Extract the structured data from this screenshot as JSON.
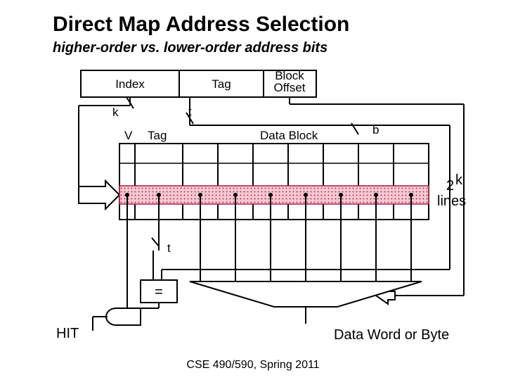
{
  "title": "Direct Map Address Selection",
  "subtitle": "higher-order vs. lower-order address bits",
  "footer": "CSE 490/590, Spring 2011",
  "addr": {
    "index": "Index",
    "tag": "Tag",
    "offset": "Block\nOffset"
  },
  "widths": {
    "k": "k",
    "t_upper": "t",
    "b": "b",
    "t_lower": "t"
  },
  "mem": {
    "V": "V",
    "Tag": "Tag",
    "Data": "Data Block"
  },
  "lines_label": {
    "two": "2",
    "k": "k",
    "suffix": "lines"
  },
  "cmp": "=",
  "hit": "HIT",
  "out": "Data Word or Byte"
}
